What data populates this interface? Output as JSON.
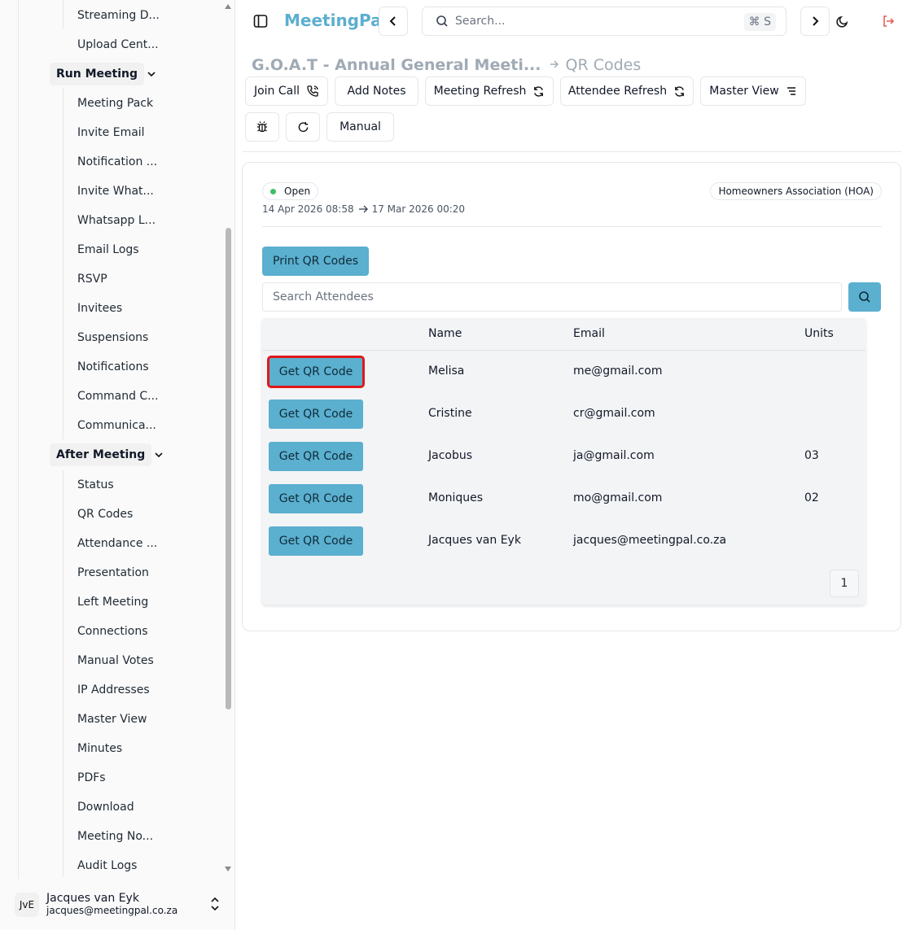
{
  "app": {
    "brand": "MeetingPal"
  },
  "sidebar": {
    "items_top": [
      {
        "label": "Streaming D..."
      },
      {
        "label": "Upload Cent..."
      }
    ],
    "run_meeting": {
      "label": "Run Meeting",
      "items": [
        {
          "label": "Meeting Pack"
        },
        {
          "label": "Invite Email"
        },
        {
          "label": "Notification ..."
        },
        {
          "label": "Invite What..."
        },
        {
          "label": "Whatsapp L..."
        },
        {
          "label": "Email Logs"
        },
        {
          "label": "RSVP"
        },
        {
          "label": "Invitees"
        },
        {
          "label": "Suspensions"
        },
        {
          "label": "Notifications"
        },
        {
          "label": "Command C..."
        },
        {
          "label": "Communica..."
        }
      ]
    },
    "after_meeting": {
      "label": "After Meeting",
      "items": [
        {
          "label": "Status"
        },
        {
          "label": "QR Codes"
        },
        {
          "label": "Attendance ..."
        },
        {
          "label": "Presentation"
        },
        {
          "label": "Left Meeting"
        },
        {
          "label": "Connections"
        },
        {
          "label": "Manual Votes"
        },
        {
          "label": "IP Addresses"
        },
        {
          "label": "Master View"
        },
        {
          "label": "Minutes"
        },
        {
          "label": "PDFs"
        },
        {
          "label": "Download"
        },
        {
          "label": "Meeting No..."
        },
        {
          "label": "Audit Logs"
        }
      ]
    },
    "user": {
      "initials": "JvE",
      "name": "Jacques van Eyk",
      "email": "jacques@meetingpal.co.za"
    }
  },
  "topbar": {
    "search_placeholder": "Search...",
    "shortcut": "⌘ S"
  },
  "breadcrumb": {
    "meeting": "G.O.A.T - Annual General Meeti...",
    "page": "QR Codes"
  },
  "actions": {
    "join_call": "Join Call",
    "add_notes": "Add Notes",
    "meeting_refresh": "Meeting Refresh",
    "attendee_refresh": "Attendee Refresh",
    "master_view": "Master View",
    "manual": "Manual"
  },
  "meeting": {
    "status": "Open",
    "start": "14 Apr 2026 08:58",
    "end": "17 Mar 2026 00:20",
    "org_type": "Homeowners Association (HOA)"
  },
  "qr": {
    "print_label": "Print QR Codes",
    "search_placeholder": "Search Attendees",
    "columns": {
      "name": "Name",
      "email": "Email",
      "units": "Units"
    },
    "button_label": "Get QR Code",
    "rows": [
      {
        "name": "Melisa",
        "email": "me@gmail.com",
        "units": ""
      },
      {
        "name": "Cristine",
        "email": "cr@gmail.com",
        "units": ""
      },
      {
        "name": "Jacobus",
        "email": "ja@gmail.com",
        "units": "03"
      },
      {
        "name": "Moniques",
        "email": "mo@gmail.com",
        "units": "02"
      },
      {
        "name": "Jacques van Eyk",
        "email": "jacques@meetingpal.co.za",
        "units": ""
      }
    ],
    "page": "1"
  },
  "colors": {
    "accent": "#5bafcf",
    "status_open": "#3fbf6a",
    "highlight": "#e01818",
    "logout": "#e05a4a"
  }
}
